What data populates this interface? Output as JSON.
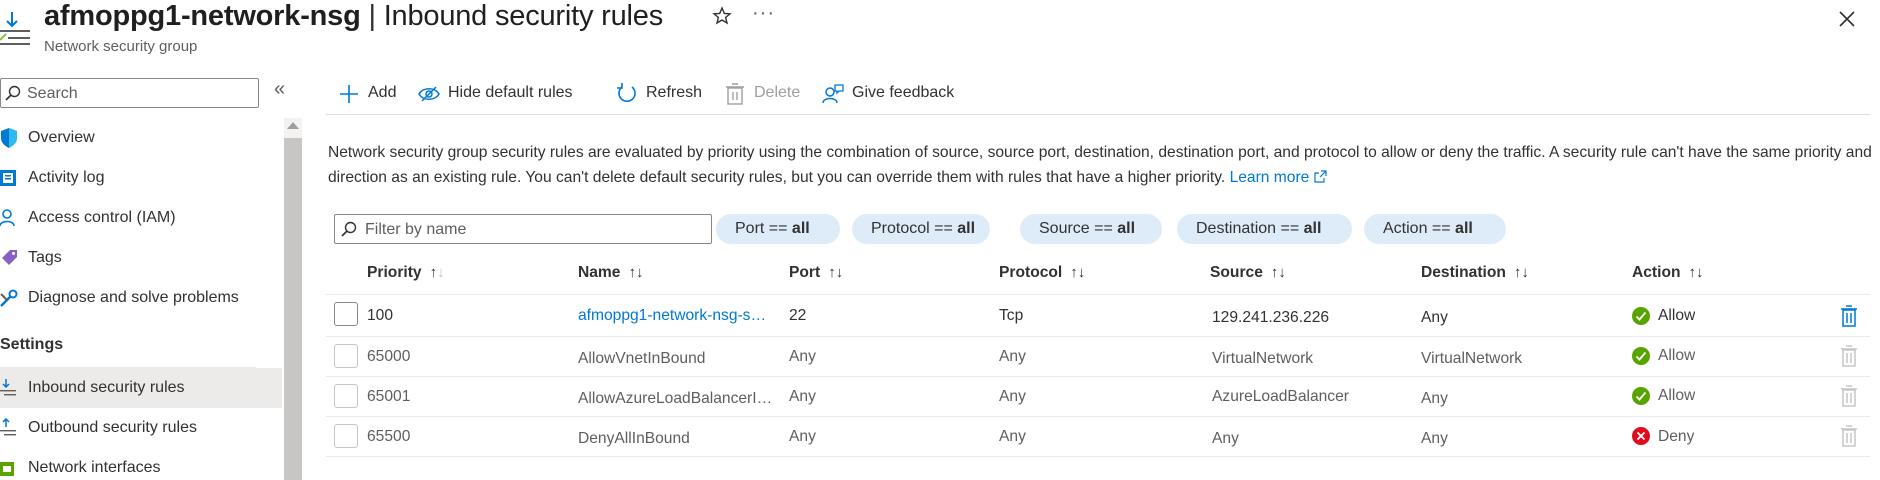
{
  "header": {
    "resource_name": "afmoppg1-network-nsg",
    "separator": " | ",
    "page_name": "Inbound security rules",
    "subtitle": "Network security group",
    "more_label": "···"
  },
  "sidebar": {
    "search_placeholder": "Search",
    "collapse_glyph": "«",
    "items": [
      {
        "label": "Overview",
        "icon": "shield-icon"
      },
      {
        "label": "Activity log",
        "icon": "activity-log-icon"
      },
      {
        "label": "Access control (IAM)",
        "icon": "people-icon"
      },
      {
        "label": "Tags",
        "icon": "tag-icon"
      },
      {
        "label": "Diagnose and solve problems",
        "icon": "wrench-icon"
      }
    ],
    "section_label": "Settings",
    "settings_items": [
      {
        "label": "Inbound security rules",
        "icon": "inbound-icon",
        "active": true
      },
      {
        "label": "Outbound security rules",
        "icon": "outbound-icon",
        "active": false
      },
      {
        "label": "Network interfaces",
        "icon": "network-interface-icon",
        "active": false
      }
    ]
  },
  "toolbar": {
    "add_label": "Add",
    "hide_default_label": "Hide default rules",
    "refresh_label": "Refresh",
    "delete_label": "Delete",
    "feedback_label": "Give feedback"
  },
  "description": {
    "text": "Network security group security rules are evaluated by priority using the combination of source, source port, destination, destination port, and protocol to allow or deny the traffic. A security rule can't have the same priority and direction as an existing rule. You can't delete default security rules, but you can override them with rules that have a higher priority.",
    "link_label": "Learn more"
  },
  "filters": {
    "name_placeholder": "Filter by name",
    "pills": [
      {
        "label": "Port == ",
        "value": "all"
      },
      {
        "label": "Protocol == ",
        "value": "all"
      },
      {
        "label": "Source == ",
        "value": "all"
      },
      {
        "label": "Destination == ",
        "value": "all"
      },
      {
        "label": "Action == ",
        "value": "all"
      }
    ]
  },
  "table": {
    "columns": [
      "Priority",
      "Name",
      "Port",
      "Protocol",
      "Source",
      "Destination",
      "Action"
    ],
    "rows": [
      {
        "priority": "100",
        "name": "afmoppg1-network-nsg-s…",
        "port": "22",
        "protocol": "Tcp",
        "source": "129.241.236.226",
        "destination": "Any",
        "action": "Allow"
      },
      {
        "priority": "65000",
        "name": "AllowVnetInBound",
        "port": "Any",
        "protocol": "Any",
        "source": "VirtualNetwork",
        "destination": "VirtualNetwork",
        "action": "Allow"
      },
      {
        "priority": "65001",
        "name": "AllowAzureLoadBalancerI…",
        "port": "Any",
        "protocol": "Any",
        "source": "AzureLoadBalancer",
        "destination": "Any",
        "action": "Allow"
      },
      {
        "priority": "65500",
        "name": "DenyAllInBound",
        "port": "Any",
        "protocol": "Any",
        "source": "Any",
        "destination": "Any",
        "action": "Deny"
      }
    ]
  },
  "colors": {
    "accent": "#0078d4",
    "allow_green": "#57a300",
    "deny_red": "#e00b1c",
    "pill_bg": "#deecf9"
  }
}
